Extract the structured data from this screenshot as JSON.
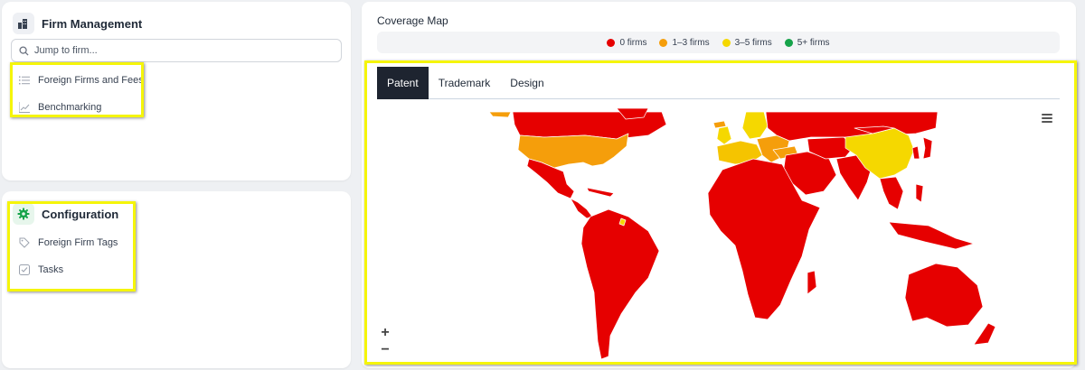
{
  "firm_management": {
    "title": "Firm Management",
    "search_placeholder": "Jump to firm...",
    "items": [
      {
        "label": "Foreign Firms and Fees",
        "icon": "list-icon"
      },
      {
        "label": "Benchmarking",
        "icon": "line-chart-icon"
      }
    ]
  },
  "configuration": {
    "title": "Configuration",
    "items": [
      {
        "label": "Foreign Firm Tags",
        "icon": "tag-icon"
      },
      {
        "label": "Tasks",
        "icon": "checkbox-icon"
      }
    ]
  },
  "coverage_map": {
    "title": "Coverage Map",
    "legend": [
      {
        "label": "0 firms",
        "color": "#e60000"
      },
      {
        "label": "1–3 firms",
        "color": "#f59e0b"
      },
      {
        "label": "3–5 firms",
        "color": "#f5d800"
      },
      {
        "label": "5+ firms",
        "color": "#16a34a"
      }
    ],
    "tabs": [
      {
        "label": "Patent",
        "active": true
      },
      {
        "label": "Trademark",
        "active": false
      },
      {
        "label": "Design",
        "active": false
      }
    ],
    "zoom_in": "+",
    "zoom_out": "−",
    "region_colors": {
      "north_america_usa": "#f59e0b",
      "china": "#f5d800",
      "europe_partial": "#f5c400",
      "other": "#e60000"
    }
  },
  "accent": {
    "highlight": "#f5f50a",
    "config_icon": "#16a34a"
  }
}
